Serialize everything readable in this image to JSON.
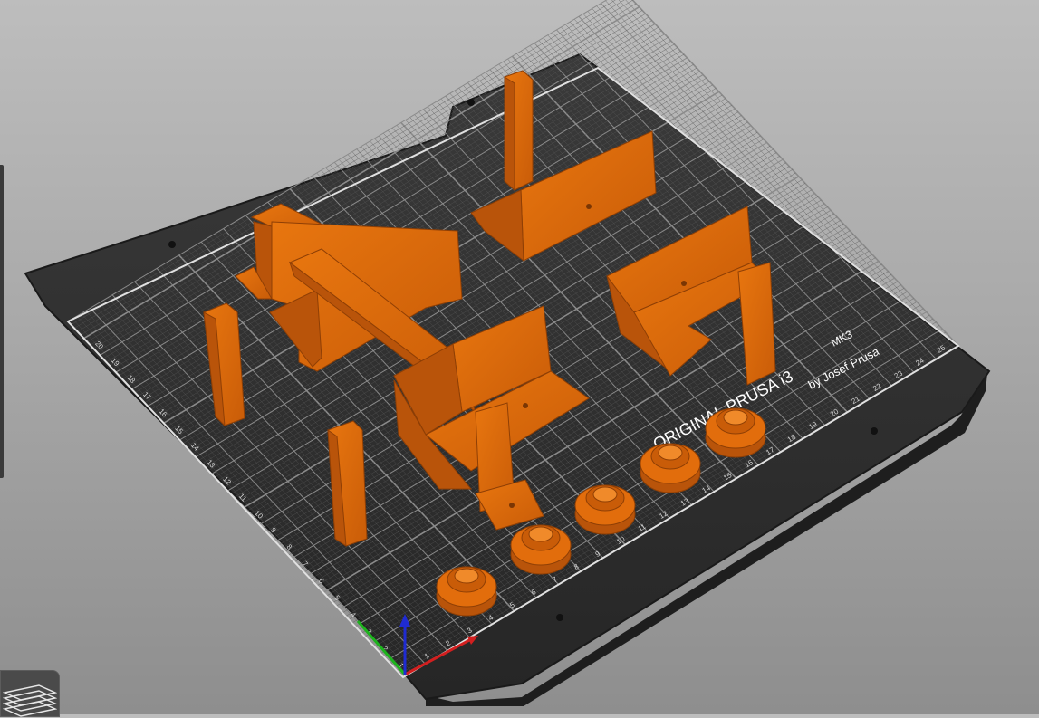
{
  "bed": {
    "brand": "ORIGINAL PRUSA i3",
    "model": "MK3",
    "byline": "by Josef Prusa",
    "ticks_x": [
      "1",
      "2",
      "3",
      "4",
      "5",
      "6",
      "7",
      "8",
      "9",
      "10",
      "11",
      "12",
      "13",
      "14",
      "15",
      "16",
      "17",
      "18",
      "19",
      "20",
      "21",
      "22",
      "23",
      "24",
      "25"
    ],
    "ticks_y": [
      "1",
      "2",
      "3",
      "4",
      "5",
      "6",
      "7",
      "8",
      "9",
      "10",
      "11",
      "12",
      "13",
      "14",
      "15",
      "16",
      "17",
      "18",
      "19",
      "20"
    ]
  },
  "colors": {
    "background_top": "#bdbdbd",
    "background_bottom": "#8e8e8e",
    "bed": "#2f2f2f",
    "part": "#d9650b",
    "part_shadow": "#a94c06",
    "axis_x": "#d21f1f",
    "axis_y": "#1db31d",
    "axis_z": "#1f2bd2"
  },
  "icons": {
    "layers": "layers-icon"
  }
}
